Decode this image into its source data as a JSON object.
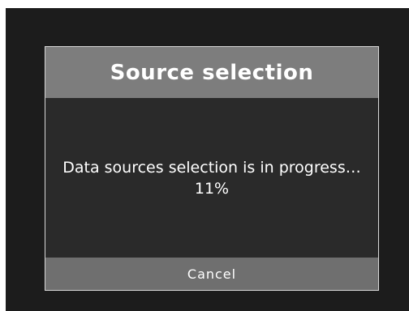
{
  "dialog": {
    "title": "Source selection",
    "message": "Data sources selection is in progress…",
    "progress_text": "11%",
    "progress": 0.11,
    "cancel_label": "Cancel"
  },
  "colors": {
    "screen_background": "#1c1c1c",
    "dialog_background": "#2a2a2a",
    "header_background": "#7d7d7d",
    "footer_background": "#6f6f6f",
    "border": "#d8d8d8",
    "text": "#ffffff"
  }
}
